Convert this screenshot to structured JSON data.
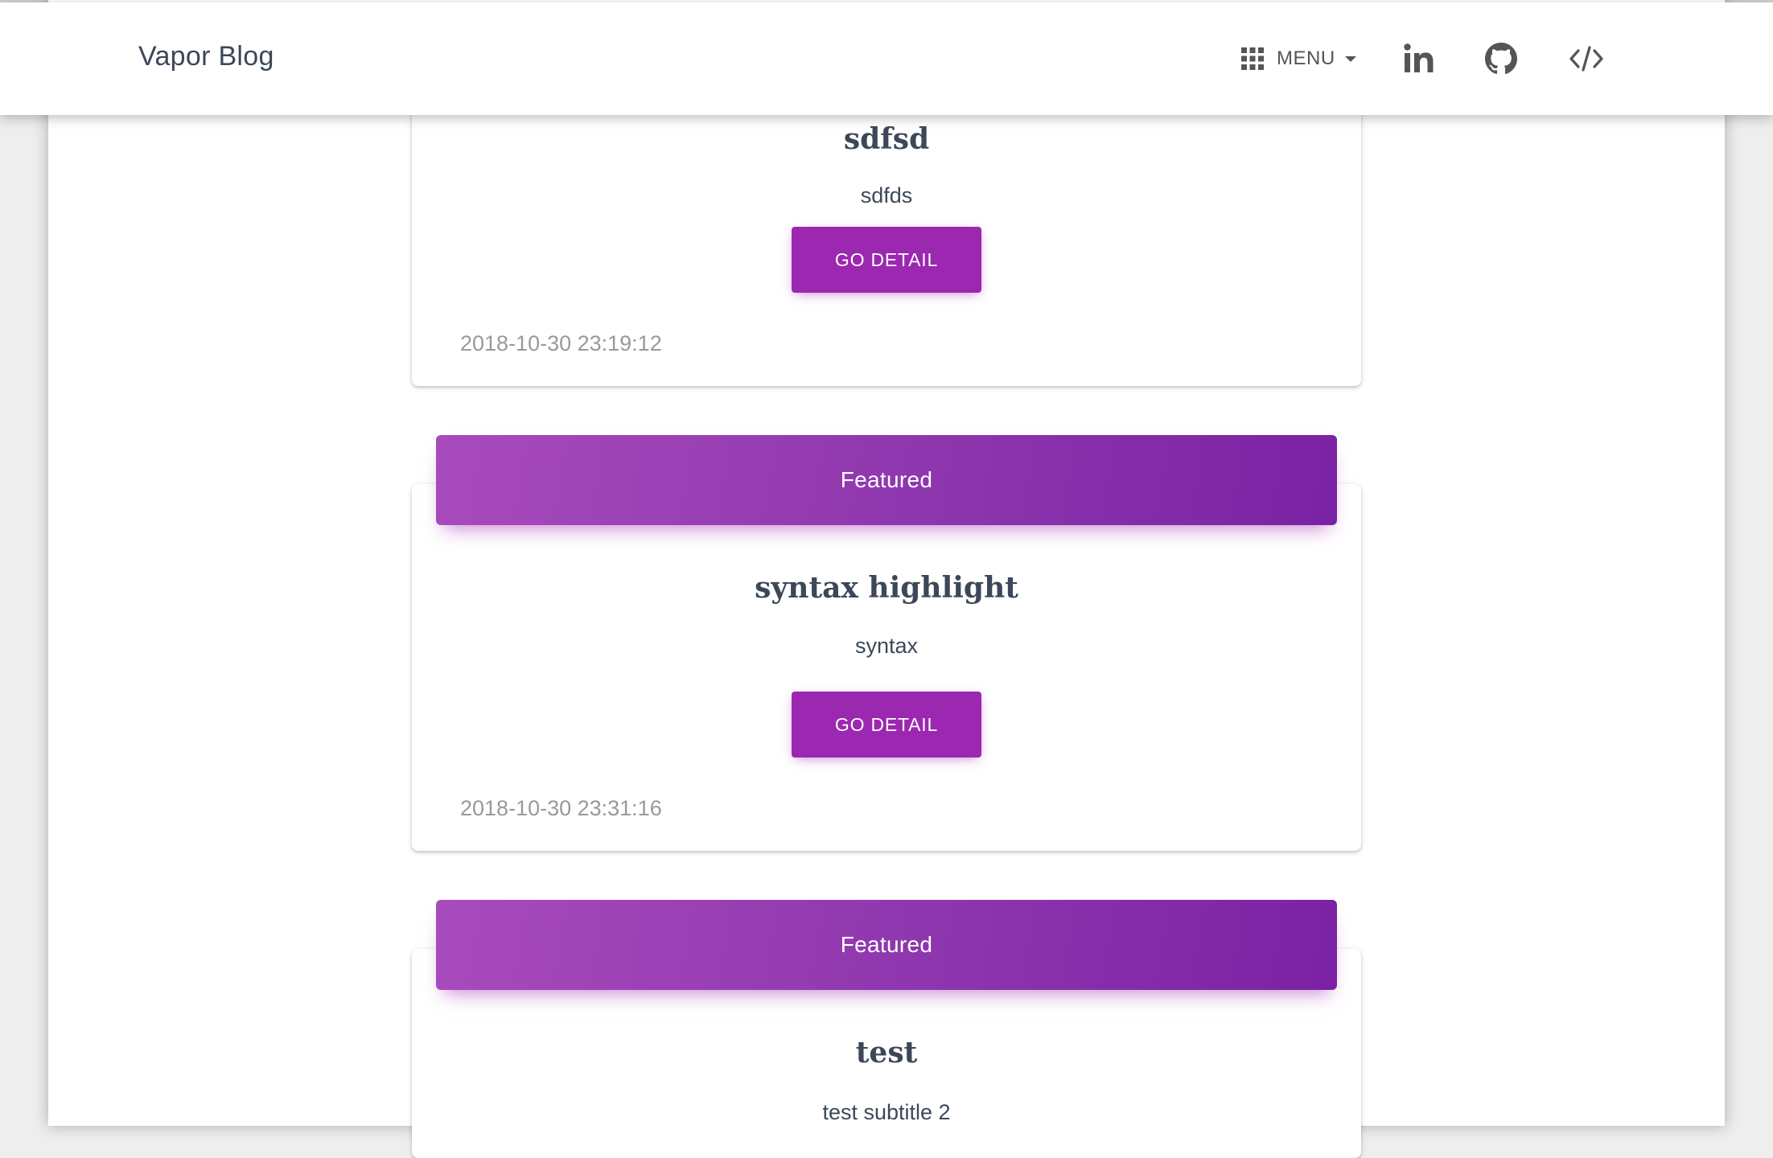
{
  "navbar": {
    "brand": "Vapor Blog",
    "menu_label": "MENU",
    "icons": [
      "apps-grid-icon",
      "linkedin-icon",
      "github-icon",
      "code-icon"
    ]
  },
  "colors": {
    "accent": "#9c27b0",
    "featured_gradient_start": "#a84bbc",
    "featured_gradient_end": "#7a22a3",
    "title_text": "#3c4858",
    "date_text": "#999999"
  },
  "posts": [
    {
      "title": "sdfsd",
      "subtitle": "sdfds",
      "button": "GO DETAIL",
      "date": "2018-10-30 23:19:12"
    },
    {
      "badge": "Featured",
      "title": "syntax highlight",
      "subtitle": "syntax",
      "button": "GO DETAIL",
      "date": "2018-10-30 23:31:16"
    },
    {
      "badge": "Featured",
      "title": "test",
      "subtitle": "test subtitle 2"
    }
  ]
}
